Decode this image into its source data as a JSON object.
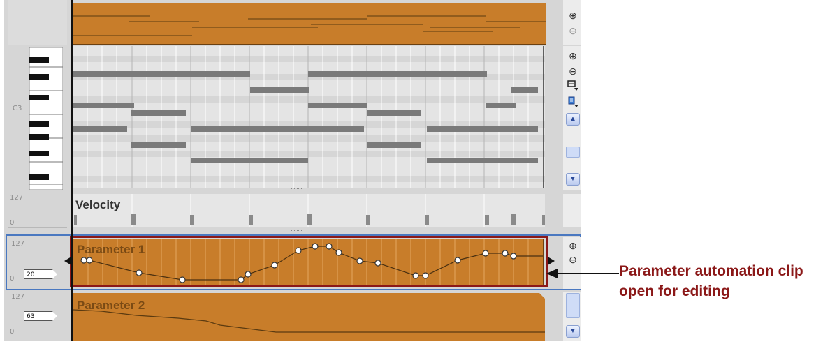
{
  "overview": {
    "zoom_in_icon": "⊕",
    "zoom_out_icon": "⊖"
  },
  "piano_roll": {
    "note_label": "C3",
    "zoom_in_icon": "⊕",
    "zoom_out_icon": "⊖",
    "scroll_up_icon": "▲",
    "scroll_down_icon": "▼"
  },
  "velocity": {
    "title": "Velocity",
    "max_label": "127",
    "min_label": "0"
  },
  "param1": {
    "title": "Parameter 1",
    "max_label": "127",
    "min_label": "0",
    "value": "20",
    "zoom_in_icon": "⊕",
    "zoom_out_icon": "⊖"
  },
  "param2": {
    "title": "Parameter 2",
    "max_label": "127",
    "min_label": "0",
    "value": "63",
    "scroll_down_icon": "▼"
  },
  "callout": {
    "text": "Parameter automation clip open for editing"
  },
  "colors": {
    "clip_orange": "#c87d2a",
    "highlight_border": "#8b1818",
    "note_gray": "#7a7a7a"
  }
}
